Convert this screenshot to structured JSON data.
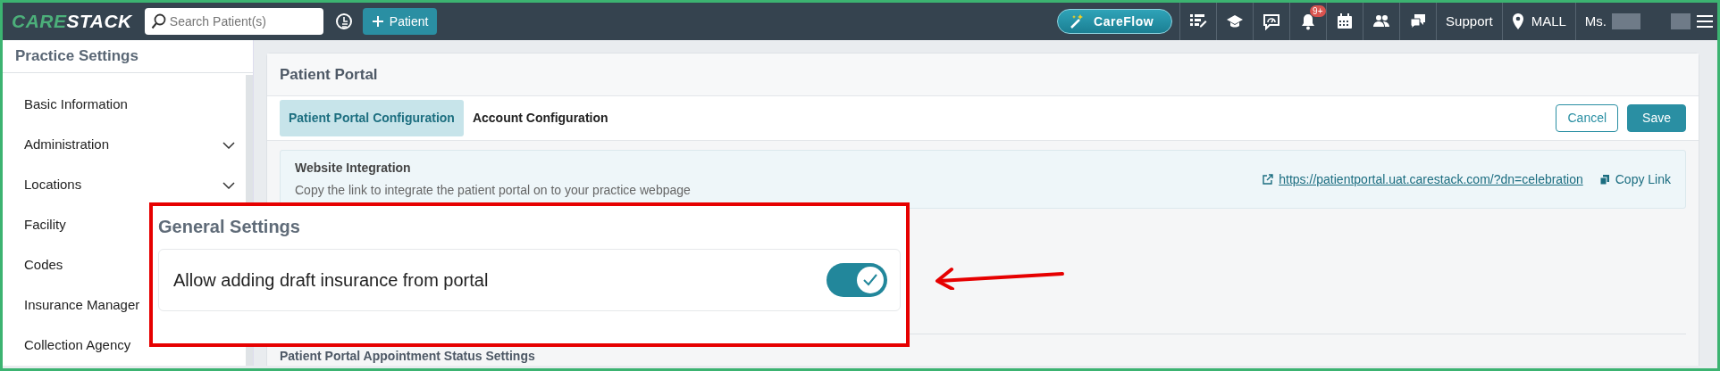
{
  "navbar": {
    "logo": [
      "CARE",
      "STACK"
    ],
    "search": {
      "placeholder": "Search Patient(s)"
    },
    "add_button": "Patient",
    "careflow_button": "CareFlow",
    "notification_badge": "9+",
    "support": "Support",
    "location": "MALL",
    "user": "Ms."
  },
  "sidebar": {
    "title": "Practice Settings",
    "items": [
      {
        "label": "Basic Information",
        "expandable": false
      },
      {
        "label": "Administration",
        "expandable": true
      },
      {
        "label": "Locations",
        "expandable": true
      },
      {
        "label": "Facility",
        "expandable": false
      },
      {
        "label": "Codes",
        "expandable": false
      },
      {
        "label": "Insurance Manager",
        "expandable": false
      },
      {
        "label": "Collection Agency",
        "expandable": false
      }
    ]
  },
  "panel": {
    "title": "Patient Portal",
    "tabs": [
      {
        "label": "Patient Portal Configuration",
        "selected": true
      },
      {
        "label": "Account Configuration",
        "selected": false
      }
    ],
    "cancel_button": "Cancel",
    "save_button": "Save",
    "website_integration": {
      "title": "Website Integration",
      "description": "Copy the link to integrate the patient portal on to your practice webpage",
      "link": "https://patientportal.uat.carestack.com/?dn=celebration",
      "copy_link": "Copy Link"
    },
    "next_section": "Patient Portal Appointment Status Settings"
  },
  "callout": {
    "heading": "General Settings",
    "setting": {
      "label": "Allow adding draft insurance from portal",
      "on": true
    }
  }
}
